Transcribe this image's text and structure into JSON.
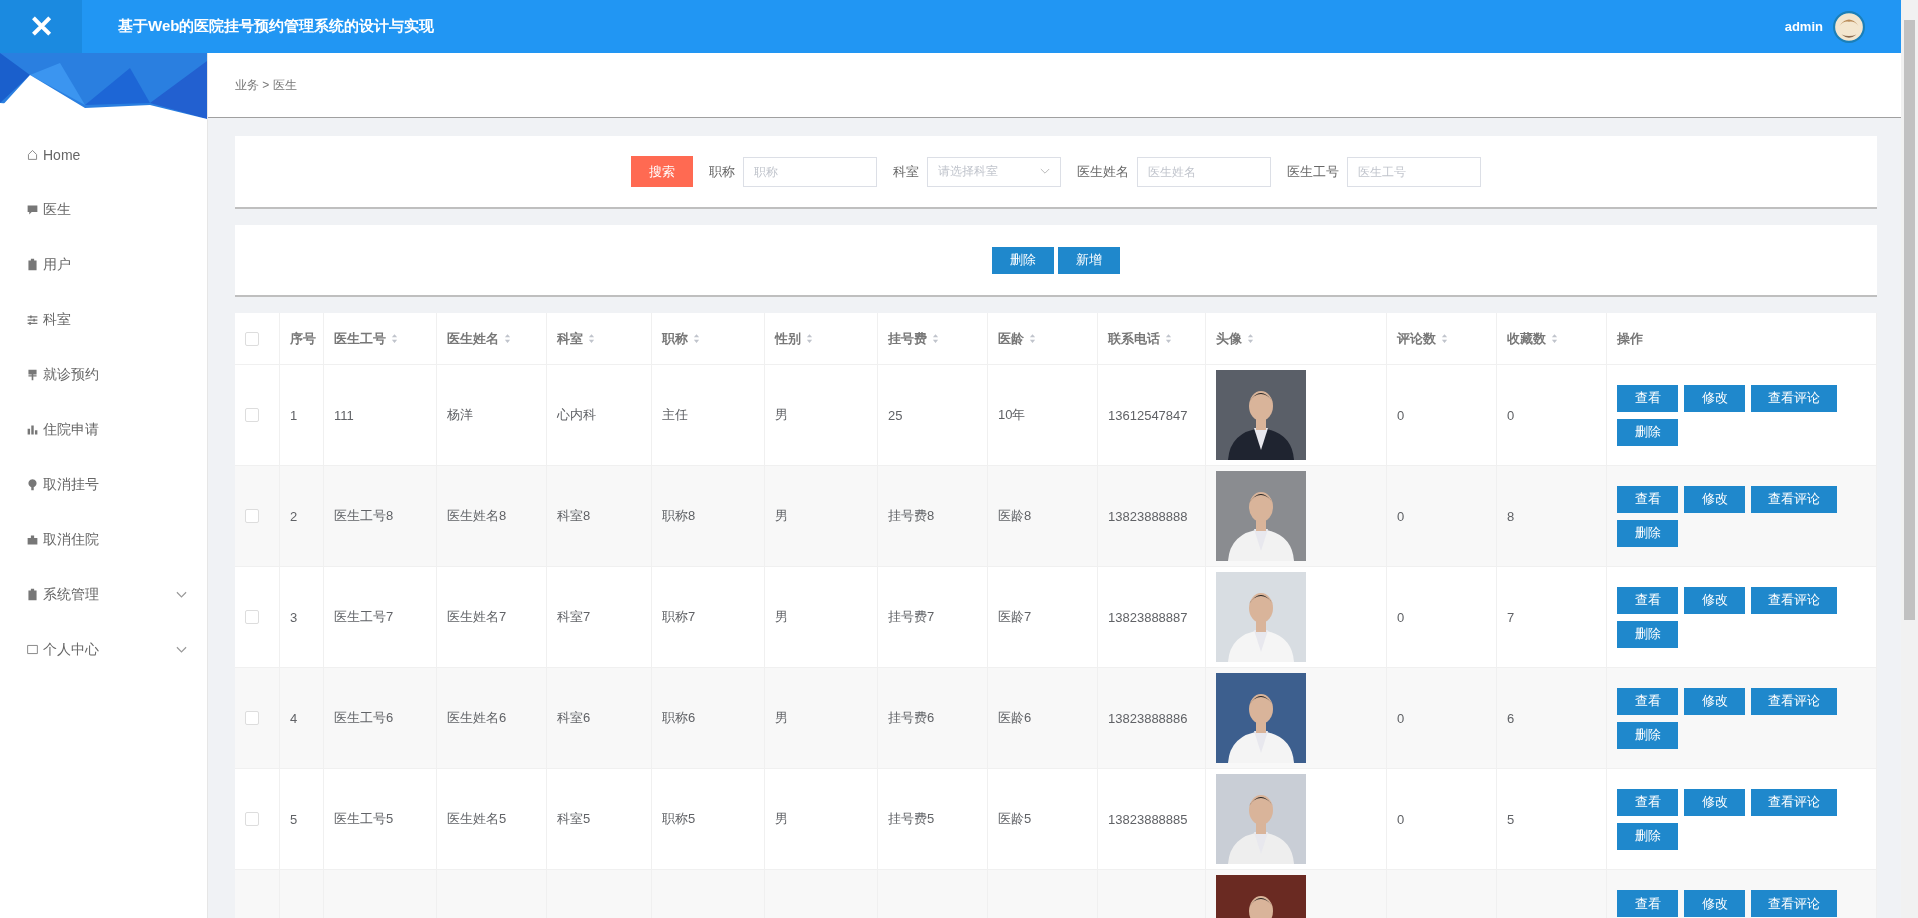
{
  "header": {
    "close": "✕",
    "title": "基于Web的医院挂号预约管理系统的设计与实现",
    "user": "admin"
  },
  "sidebar": {
    "items": [
      {
        "label": "Home"
      },
      {
        "label": "医生"
      },
      {
        "label": "用户"
      },
      {
        "label": "科室"
      },
      {
        "label": "就诊预约"
      },
      {
        "label": "住院申请"
      },
      {
        "label": "取消挂号"
      },
      {
        "label": "取消住院"
      },
      {
        "label": "系统管理",
        "expanded": false
      },
      {
        "label": "个人中心",
        "expanded": false
      }
    ]
  },
  "breadcrumb": "业务 > 医生",
  "search": {
    "button": "搜索",
    "fields": [
      {
        "label": "职称",
        "placeholder": "职称",
        "kind": "input"
      },
      {
        "label": "科室",
        "placeholder": "请选择科室",
        "kind": "select"
      },
      {
        "label": "医生姓名",
        "placeholder": "医生姓名",
        "kind": "input"
      },
      {
        "label": "医生工号",
        "placeholder": "医生工号",
        "kind": "input"
      }
    ]
  },
  "toolbar": [
    "删除",
    "新增"
  ],
  "table": {
    "select_all": {
      "checked": false
    },
    "columns": [
      {
        "label": "序号",
        "sortable": false
      },
      {
        "label": "医生工号",
        "sortable": true
      },
      {
        "label": "医生姓名",
        "sortable": true
      },
      {
        "label": "科室",
        "sortable": true
      },
      {
        "label": "职称",
        "sortable": true
      },
      {
        "label": "性别",
        "sortable": true
      },
      {
        "label": "挂号费",
        "sortable": true
      },
      {
        "label": "医龄",
        "sortable": true
      },
      {
        "label": "联系电话",
        "sortable": true
      },
      {
        "label": "头像",
        "sortable": true
      },
      {
        "label": "评论数",
        "sortable": true
      },
      {
        "label": "收藏数",
        "sortable": true
      },
      {
        "label": "操作",
        "sortable": false
      }
    ],
    "rows": [
      {
        "selected": false,
        "cells": [
          "1",
          "111",
          "杨洋",
          "心内科",
          "主任",
          "男",
          "25",
          "10年",
          "13612547847"
        ],
        "photo": {
          "kind": "picture"
        },
        "counts": [
          "0",
          "0"
        ],
        "actions": [
          "查看",
          "修改",
          "查看评论",
          "删除"
        ]
      },
      {
        "selected": false,
        "cells": [
          "2",
          "医生工号8",
          "医生姓名8",
          "科室8",
          "职称8",
          "男",
          "挂号费8",
          "医龄8",
          "13823888888"
        ],
        "photo": {
          "kind": "picture"
        },
        "counts": [
          "0",
          "8"
        ],
        "actions": [
          "查看",
          "修改",
          "查看评论",
          "删除"
        ]
      },
      {
        "selected": false,
        "cells": [
          "3",
          "医生工号7",
          "医生姓名7",
          "科室7",
          "职称7",
          "男",
          "挂号费7",
          "医龄7",
          "13823888887"
        ],
        "photo": {
          "kind": "picture"
        },
        "counts": [
          "0",
          "7"
        ],
        "actions": [
          "查看",
          "修改",
          "查看评论",
          "删除"
        ]
      },
      {
        "selected": false,
        "cells": [
          "4",
          "医生工号6",
          "医生姓名6",
          "科室6",
          "职称6",
          "男",
          "挂号费6",
          "医龄6",
          "13823888886"
        ],
        "photo": {
          "kind": "picture"
        },
        "counts": [
          "0",
          "6"
        ],
        "actions": [
          "查看",
          "修改",
          "查看评论",
          "删除"
        ]
      },
      {
        "selected": false,
        "cells": [
          "5",
          "医生工号5",
          "医生姓名5",
          "科室5",
          "职称5",
          "男",
          "挂号费5",
          "医龄5",
          "13823888885"
        ],
        "photo": {
          "kind": "picture"
        },
        "counts": [
          "0",
          "5"
        ],
        "actions": [
          "查看",
          "修改",
          "查看评论",
          "删除"
        ]
      },
      {
        "photo": {
          "kind": "picture"
        },
        "actions": [
          "查看",
          "修改",
          "查看评论"
        ]
      }
    ]
  }
}
